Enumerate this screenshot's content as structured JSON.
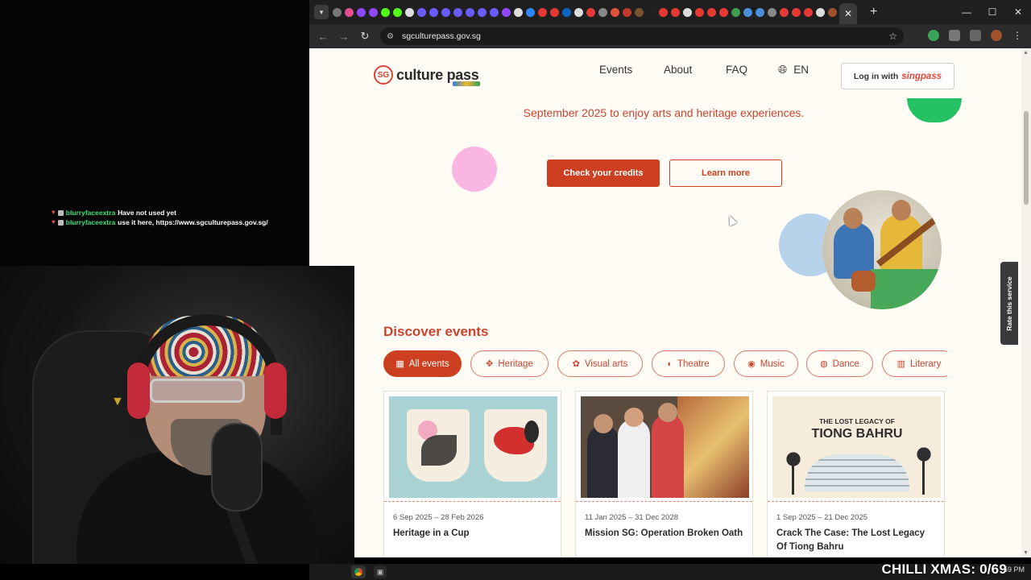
{
  "stream": {
    "chat": [
      {
        "user": "blurryfaceextra",
        "message": "Have not used yet"
      },
      {
        "user": "blurryfaceextra",
        "message": "use it here, https://www.sgculturepass.gov.sg/"
      }
    ],
    "alert": "CHILLI XMAS: 0/69",
    "time": "59 PM"
  },
  "browser": {
    "url": "sgculturepass.gov.sg",
    "active_tab_icon": "close-icon"
  },
  "site": {
    "logo_badge": "SG",
    "logo_text": "culture pass",
    "nav": {
      "events": "Events",
      "about": "About",
      "faq": "FAQ",
      "lang": "EN"
    },
    "login": {
      "prefix": "Log in with",
      "brand": "singpass"
    },
    "hero": {
      "text": "September 2025 to enjoy arts and heritage experiences.",
      "primary_button": "Check your credits",
      "secondary_button": "Learn more"
    },
    "rate_tab": "Rate this service",
    "discover": {
      "title": "Discover events",
      "chips": [
        {
          "label": "All events",
          "icon": "grid-icon",
          "active": true
        },
        {
          "label": "Heritage",
          "icon": "heritage-icon",
          "active": false
        },
        {
          "label": "Visual arts",
          "icon": "visual-arts-icon",
          "active": false
        },
        {
          "label": "Theatre",
          "icon": "theatre-icon",
          "active": false
        },
        {
          "label": "Music",
          "icon": "music-icon",
          "active": false
        },
        {
          "label": "Dance",
          "icon": "dance-icon",
          "active": false
        },
        {
          "label": "Literary",
          "icon": "literary-icon",
          "active": false
        }
      ],
      "cards": [
        {
          "date": "6 Sep 2025 – 28 Feb 2026",
          "title": "Heritage in a Cup"
        },
        {
          "date": "11 Jan 2025 – 31 Dec 2028",
          "title": "Mission SG: Operation Broken Oath"
        },
        {
          "date": "1 Sep 2025 – 21 Dec 2025",
          "title": "Crack The Case: The Lost Legacy Of Tiong Bahru"
        }
      ],
      "card3_image_text": {
        "line1": "THE LOST LEGACY OF",
        "line2": "TIONG BAHRU"
      }
    }
  },
  "colors": {
    "brand_red": "#cc3f20",
    "page_bg": "#fffcf6",
    "chat_user": "#3ee07a"
  }
}
